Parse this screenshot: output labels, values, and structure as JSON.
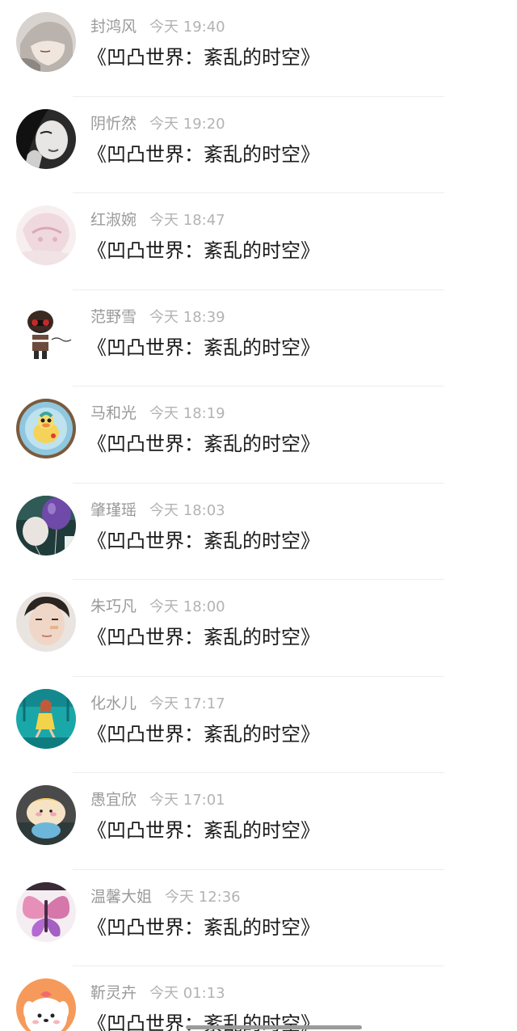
{
  "comments": [
    {
      "user": "封鸿风",
      "time": "今天 19:40",
      "text": "《凹凸世界：紊乱的时空》",
      "avatar": "sleeping-anime-boy-avatar"
    },
    {
      "user": "阴忻然",
      "time": "今天 19:20",
      "text": "《凹凸世界：紊乱的时空》",
      "avatar": "monochrome-girl-portrait-avatar"
    },
    {
      "user": "红淑婉",
      "time": "今天 18:47",
      "text": "《凹凸世界：紊乱的时空》",
      "avatar": "pastel-anime-girl-avatar"
    },
    {
      "user": "范野雪",
      "time": "今天 18:39",
      "text": "《凹凸世界：紊乱的时空》",
      "avatar": "cartoon-hello-character-avatar"
    },
    {
      "user": "马和光",
      "time": "今天 18:19",
      "text": "《凹凸世界：紊乱的时空》",
      "avatar": "duck-plate-avatar"
    },
    {
      "user": "肇瑾瑶",
      "time": "今天 18:03",
      "text": "《凹凸世界：紊乱的时空》",
      "avatar": "purple-balloon-avatar"
    },
    {
      "user": "朱巧凡",
      "time": "今天 18:00",
      "text": "《凹凸世界：紊乱的时空》",
      "avatar": "young-man-portrait-avatar"
    },
    {
      "user": "化水儿",
      "time": "今天 17:17",
      "text": "《凹凸世界：紊乱的时空》",
      "avatar": "teal-illustration-girl-avatar"
    },
    {
      "user": "愚宜欣",
      "time": "今天 17:01",
      "text": "《凹凸世界：紊乱的时空》",
      "avatar": "plush-toy-avatar"
    },
    {
      "user": "温馨大姐",
      "time": "今天 12:36",
      "text": "《凹凸世界：紊乱的时空》",
      "avatar": "pink-butterfly-avatar"
    },
    {
      "user": "靳灵卉",
      "time": "今天 01:13",
      "text": "《凹凸世界：紊乱的时空》",
      "avatar": "cute-white-dog-avatar"
    }
  ]
}
